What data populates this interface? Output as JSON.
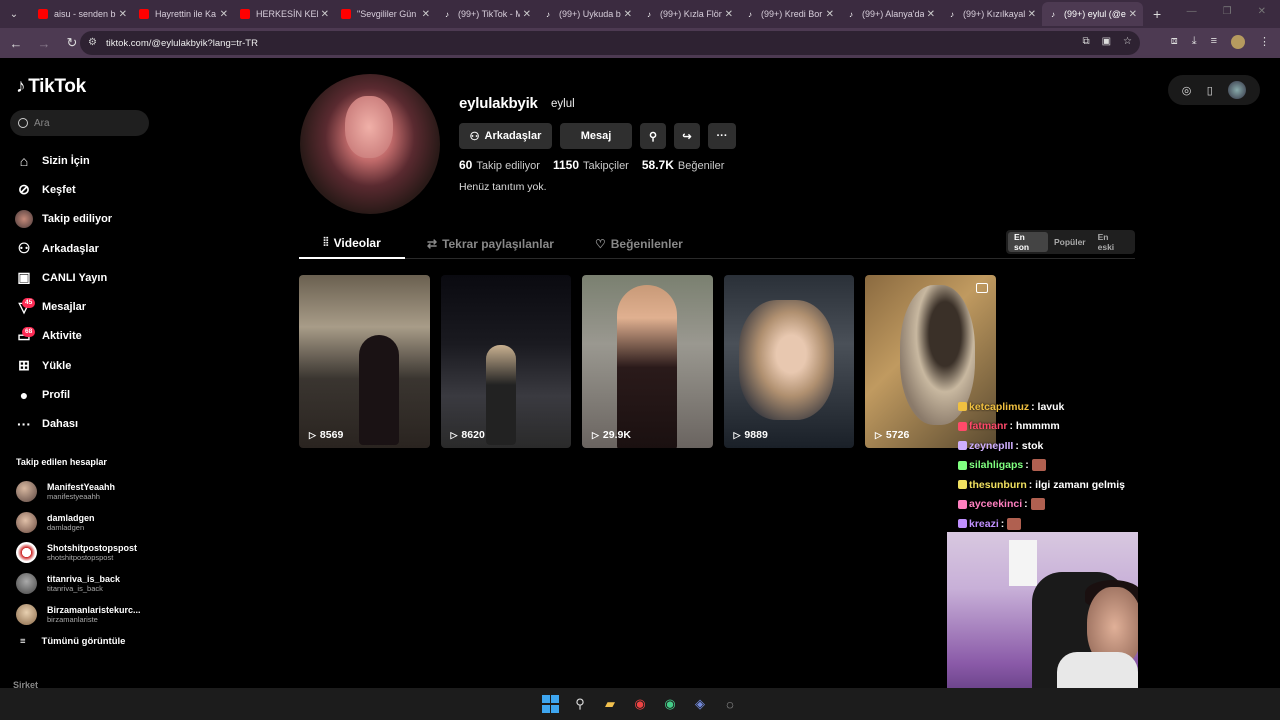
{
  "browser": {
    "tabs": [
      {
        "label": "aisu - senden b",
        "icon": "youtube-icon",
        "active": false
      },
      {
        "label": "Hayrettin ile Ka",
        "icon": "youtube-icon",
        "active": false
      },
      {
        "label": "HERKESİN KEN",
        "icon": "youtube-icon",
        "active": false
      },
      {
        "label": "\"Sevgililer Gün",
        "icon": "youtube-icon",
        "active": false
      },
      {
        "label": "(99+) TikTok - M",
        "icon": "tiktok-icon",
        "active": false
      },
      {
        "label": "(99+) Uykuda b",
        "icon": "tiktok-icon",
        "active": false
      },
      {
        "label": "(99+) Kızla Flört",
        "icon": "tiktok-icon",
        "active": false
      },
      {
        "label": "(99+) Kredi Bor",
        "icon": "tiktok-icon",
        "active": false
      },
      {
        "label": "(99+) Alanya'da",
        "icon": "tiktok-icon",
        "active": false
      },
      {
        "label": "(99+) Kızılkayal",
        "icon": "tiktok-icon",
        "active": false
      },
      {
        "label": "(99+) eylul (@e",
        "icon": "tiktok-icon",
        "active": true
      }
    ],
    "url": "tiktok.com/@eylulakbyik?lang=tr-TR"
  },
  "sidebar": {
    "logo": "TikTok",
    "search_placeholder": "Ara",
    "nav": [
      {
        "label": "Sizin İçin",
        "icon": "home-icon"
      },
      {
        "label": "Keşfet",
        "icon": "compass-icon"
      },
      {
        "label": "Takip ediliyor",
        "icon": "following-avatar-icon"
      },
      {
        "label": "Arkadaşlar",
        "icon": "friends-icon"
      },
      {
        "label": "CANLI Yayın",
        "icon": "live-icon"
      },
      {
        "label": "Mesajlar",
        "icon": "messages-icon",
        "badge": "45"
      },
      {
        "label": "Aktivite",
        "icon": "activity-icon",
        "badge": "68"
      },
      {
        "label": "Yükle",
        "icon": "upload-icon"
      },
      {
        "label": "Profil",
        "icon": "profile-icon"
      },
      {
        "label": "Dahası",
        "icon": "more-icon"
      }
    ],
    "following_title": "Takip edilen hesaplar",
    "following": [
      {
        "name": "ManifestYeaahh",
        "user": "manifestyeaahh"
      },
      {
        "name": "damladgen",
        "user": "damladgen"
      },
      {
        "name": "Shotshitpostopspost",
        "user": "shotshitpostopspost"
      },
      {
        "name": "titanriva_is_back",
        "user": "titanriva_is_back"
      },
      {
        "name": "Birzamanlaristekurc...",
        "user": "birzamanlariste"
      }
    ],
    "see_all": "Tümünü görüntüle",
    "company": "Şirket"
  },
  "profile": {
    "username": "eylulakbyik",
    "nickname": "eylul",
    "friends_btn": "Arkadaşlar",
    "message_btn": "Mesaj",
    "following_count": "60",
    "following_label": "Takip ediliyor",
    "followers_count": "1150",
    "followers_label": "Takipçiler",
    "likes_count": "58.7K",
    "likes_label": "Beğeniler",
    "bio": "Henüz tanıtım yok."
  },
  "tabs": {
    "videos": "Videolar",
    "reposts": "Tekrar paylaşılanlar",
    "liked": "Beğenilenler"
  },
  "sort": [
    "En son",
    "Popüler",
    "En eski"
  ],
  "videos": [
    {
      "views": "8569"
    },
    {
      "views": "8620"
    },
    {
      "views": "29.9K"
    },
    {
      "views": "9889"
    },
    {
      "views": "5726"
    }
  ],
  "chat": [
    {
      "user": "ketcaplimuz",
      "color": "#f0c040",
      "msg": ": lavuk",
      "emote": false
    },
    {
      "user": "fatmanr",
      "color": "#ff4a6a",
      "msg": ": hmmmm",
      "emote": false
    },
    {
      "user": "zeynepIII",
      "color": "#d0b0ff",
      "msg": ": stok",
      "emote": false
    },
    {
      "user": "silahligaps",
      "color": "#80ff80",
      "msg": ":",
      "emote": true
    },
    {
      "user": "thesunburn",
      "color": "#f0e060",
      "msg": ": ilgi zamanı gelmiş",
      "emote": false
    },
    {
      "user": "ayceekinci",
      "color": "#ff80c0",
      "msg": ":",
      "emote": true
    },
    {
      "user": "kreazi",
      "color": "#c090ff",
      "msg": ":",
      "emote": true
    }
  ],
  "colors": {
    "tab_bar": "#3b2b40",
    "address_bar": "#4d3a52",
    "badge": "#fe2c55"
  }
}
